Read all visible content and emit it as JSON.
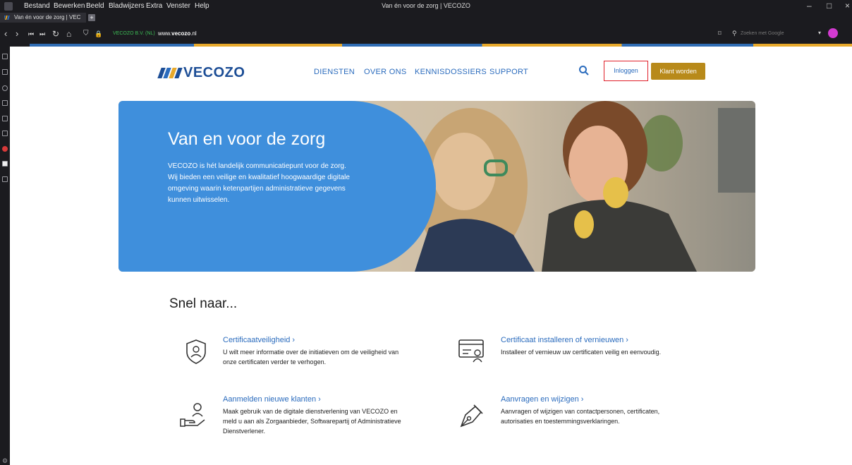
{
  "browser": {
    "menu": [
      "Bestand",
      "Bewerken",
      "Beeld",
      "Bladwijzers",
      "Extra",
      "Venster",
      "Help"
    ],
    "window_title": "Van én voor de zorg | VECOZO",
    "tab_title": "Van én voor de zorg | VEC",
    "new_tab": "+",
    "site_identity": "VECOZO B.V. (NL)",
    "url_prefix": "www.",
    "url_domain": "vecozo",
    "url_suffix": ".nl",
    "search_placeholder": "Zoeken met Google",
    "window_controls": [
      "–",
      "□",
      "×"
    ]
  },
  "site": {
    "logo_text": "VECOZO",
    "logo_colors": [
      "#1d4e96",
      "#2a6bbd",
      "#e8a92b",
      "#1d4e96"
    ],
    "nav": [
      "DIENSTEN",
      "OVER ONS",
      "KENNISDOSSIERS",
      "SUPPORT"
    ],
    "login_label": "Inloggen",
    "signup_label": "Klant worden",
    "hero": {
      "title": "Van en voor de zorg",
      "text": "VECOZO is hét landelijk communicatiepunt voor de zorg. Wij bieden een veilige en kwalitatief hoogwaardige digitale omgeving waarin ketenpartijen administratieve gegevens kunnen uitwisselen."
    },
    "snel_title": "Snel naar...",
    "cards": [
      {
        "title": "Certificaatveiligheid  ›",
        "text": "U wilt meer informatie over de initiatieven om de veiligheid van onze certificaten verder te verhogen.",
        "icon": "shield-icon"
      },
      {
        "title": "Certificaat installeren of vernieuwen  ›",
        "text": "Installeer of vernieuw uw certificaten veilig en eenvoudig.",
        "icon": "certificate-card-icon"
      },
      {
        "title": "Aanmelden nieuwe klanten  ›",
        "text": "Maak gebruik van de digitale dienstverlening van VECOZO en meld u aan als Zorgaanbieder, Softwarepartij of Administratieve Dienstverlener.",
        "icon": "hand-person-icon"
      },
      {
        "title": "Aanvragen en wijzigen  ›",
        "text": "Aanvragen of wijzigen van contactpersonen, certificaten, autorisaties en toestemmingsverklaringen.",
        "icon": "pen-nib-icon"
      }
    ]
  },
  "colors": {
    "brand_blue": "#2a6bbd",
    "hero_blue": "#3f8fdc",
    "signup_gold": "#b88a1a",
    "login_border": "#e0202a"
  }
}
